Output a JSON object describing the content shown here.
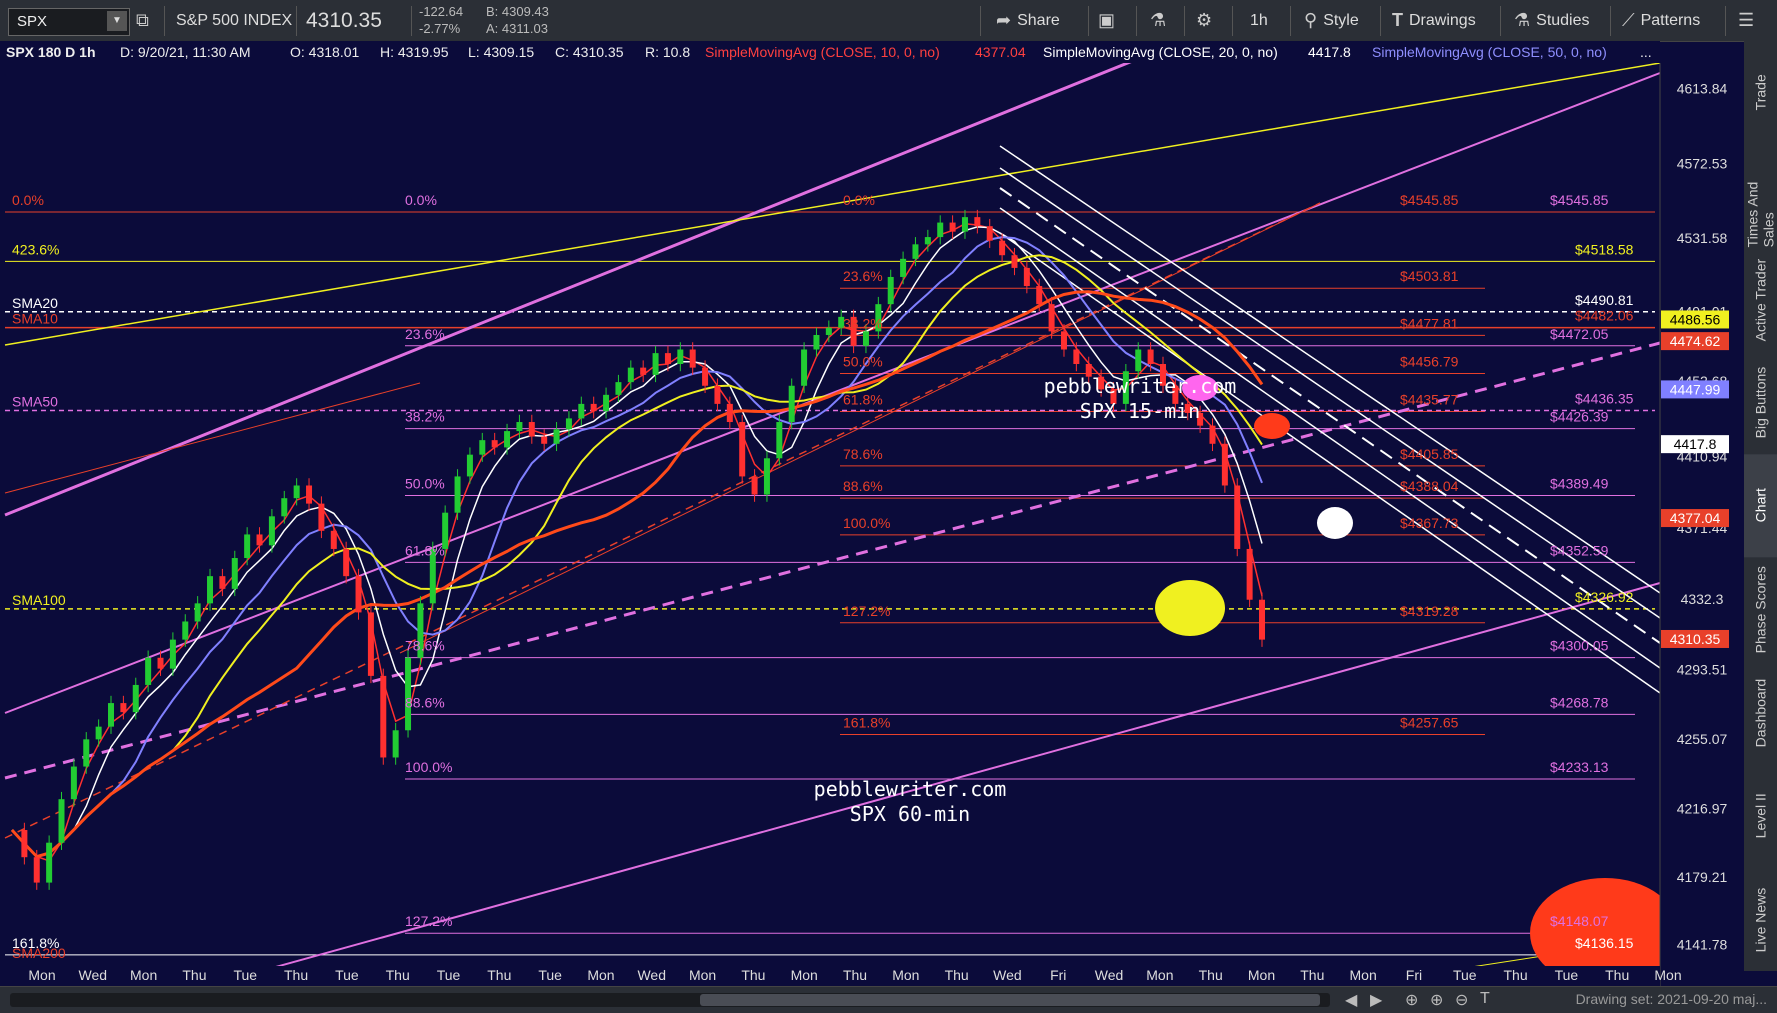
{
  "toolbar": {
    "symbol": "SPX",
    "index_name": "S&P 500 INDEX",
    "last_price": "4310.35",
    "change": "-122.64",
    "change_pct": "-2.77%",
    "bid": "B: 4309.43",
    "ask": "A: 4311.03",
    "share_label": "Share",
    "interval_label": "1h",
    "style_label": "Style",
    "drawings_label": "Drawings",
    "studies_label": "Studies",
    "patterns_label": "Patterns"
  },
  "infobar": {
    "symbol_period": "SPX 180 D 1h",
    "datetime": "D: 9/20/21, 11:30 AM",
    "open": "O: 4318.01",
    "high": "H: 4319.95",
    "low": "L: 4309.15",
    "close": "C: 4310.35",
    "range": "R: 10.8",
    "sma10_label": "SimpleMovingAvg (CLOSE, 10, 0, no)",
    "sma10_value": "4377.04",
    "sma20_label": "SimpleMovingAvg (CLOSE, 20, 0, no)",
    "sma20_value": "4417.8",
    "sma50_label": "SimpleMovingAvg (CLOSE, 50, 0, no)",
    "ellipsis": "..."
  },
  "right_tabs": [
    "Trade",
    "Times And Sales",
    "Active Trader",
    "Big Buttons",
    "Chart",
    "Phase Scores",
    "Dashboard",
    "Level II",
    "Live News"
  ],
  "bottombar": {
    "drawing_set": "Drawing set: 2021-09-20 maj..."
  },
  "colors": {
    "background": "#0b0b3a",
    "fib_red": "#e8402a",
    "fib_pink": "#e070e0",
    "yellow": "#f0f020",
    "white": "#ffffff",
    "sma200": "#ff4a1a",
    "sma50": "#8080ff"
  },
  "chart_data": {
    "type": "candlestick",
    "symbol": "SPX",
    "interval": "1h",
    "y_axis": {
      "ylim": [
        4130,
        4628
      ],
      "ticks": [
        4613.84,
        4572.53,
        4531.58,
        4491.01,
        4452.68,
        4410.94,
        4371.44,
        4332.3,
        4293.51,
        4255.07,
        4216.97,
        4179.21,
        4141.78
      ],
      "tick_labels": [
        "4613.84",
        "4572.53",
        "4531.58",
        "4491.01",
        "4452.68",
        "4410.94",
        "4371.44",
        "4332.3",
        "4293.51",
        "4255.07",
        "4216.97",
        "4179.21",
        "4141.78"
      ]
    },
    "x_axis": {
      "tick_labels": [
        "Mon",
        "Wed",
        "Mon",
        "Thu",
        "Tue",
        "Thu",
        "Tue",
        "Thu",
        "Tue",
        "Thu",
        "Tue",
        "Mon",
        "Wed",
        "Mon",
        "Thu",
        "Mon",
        "Thu",
        "Mon",
        "Thu",
        "Wed",
        "Fri",
        "Wed",
        "Mon",
        "Thu",
        "Mon",
        "Thu",
        "Mon",
        "Fri",
        "Tue",
        "Thu",
        "Tue",
        "Thu",
        "Mon"
      ]
    },
    "price_markers": [
      {
        "label": "4486.56",
        "value": 4486.56,
        "color": "#f0f020",
        "text_color": "#000000"
      },
      {
        "label": "4474.62",
        "value": 4474.62,
        "color": "#e8402a",
        "text_color": "#ffffff"
      },
      {
        "label": "4447.99",
        "value": 4447.99,
        "color": "#8080ff",
        "text_color": "#ffffff"
      },
      {
        "label": "4417.8",
        "value": 4417.8,
        "color": "#ffffff",
        "text_color": "#000000"
      },
      {
        "label": "4377.04",
        "value": 4377.04,
        "color": "#e8402a",
        "text_color": "#ffffff"
      },
      {
        "label": "4310.35",
        "value": 4310.35,
        "color": "#e8402a",
        "text_color": "#ffffff"
      }
    ],
    "fib_levels_left": [
      {
        "label": "0.0%",
        "value": 4545.85,
        "color": "#e8402a"
      },
      {
        "label": "423.6%",
        "value": 4518.58,
        "color": "#f0f020"
      },
      {
        "label": "161.8%",
        "value": 4136.15,
        "color": "#ffffff"
      }
    ],
    "fib_levels_pink": [
      {
        "label": "0.0%",
        "value": 4545.85,
        "price": "$4545.85"
      },
      {
        "label": "23.6%",
        "value": 4472.05,
        "price": "$4472.05"
      },
      {
        "label": "38.2%",
        "value": 4426.39,
        "price": "$4426.39"
      },
      {
        "label": "50.0%",
        "value": 4389.49,
        "price": "$4389.49"
      },
      {
        "label": "61.8%",
        "value": 4352.59,
        "price": "$4352.59"
      },
      {
        "label": "78.6%",
        "value": 4300.05,
        "price": "$4300.05"
      },
      {
        "label": "88.6%",
        "value": 4268.78,
        "price": "$4268.78"
      },
      {
        "label": "100.0%",
        "value": 4233.13,
        "price": "$4233.13"
      },
      {
        "label": "127.2%",
        "value": 4148.07,
        "price": "$4148.07"
      }
    ],
    "fib_levels_red": [
      {
        "label": "0.0%",
        "value": 4545.85,
        "price": "$4545.85"
      },
      {
        "label": "23.6%",
        "value": 4503.81,
        "price": "$4503.81"
      },
      {
        "label": "38.2%",
        "value": 4477.81,
        "price": "$4477.81"
      },
      {
        "label": "50.0%",
        "value": 4456.79,
        "price": "$4456.79"
      },
      {
        "label": "61.8%",
        "value": 4435.77,
        "price": "$4435.77"
      },
      {
        "label": "78.6%",
        "value": 4405.85,
        "price": "$4405.85"
      },
      {
        "label": "88.6%",
        "value": 4388.04,
        "price": "$4388.04"
      },
      {
        "label": "100.0%",
        "value": 4367.73,
        "price": "$4367.73"
      },
      {
        "label": "127.2%",
        "value": 4319.28,
        "price": "$4319.28"
      },
      {
        "label": "161.8%",
        "value": 4257.65,
        "price": "$4257.65"
      }
    ],
    "other_levels": [
      {
        "label": "$4518.58",
        "value": 4518.58,
        "color": "#f0f020"
      },
      {
        "label": "$4490.81",
        "value": 4490.81,
        "color": "#ffffff"
      },
      {
        "label": "$4482.06",
        "value": 4482.06,
        "color": "#e8402a"
      },
      {
        "label": "$4436.35",
        "value": 4436.35,
        "color": "#e070e0"
      },
      {
        "label": "$4326.92",
        "value": 4326.92,
        "color": "#f0f020"
      },
      {
        "label": "$4136.15",
        "value": 4136.15,
        "color": "#ffffff"
      }
    ],
    "sma_labels": [
      {
        "label": "SMA20",
        "value": 4490.81,
        "color": "#ffffff"
      },
      {
        "label": "SMA10",
        "value": 4482.06,
        "color": "#e8402a"
      },
      {
        "label": "SMA50",
        "value": 4436.35,
        "color": "#e070e0"
      },
      {
        "label": "SMA100",
        "value": 4326.92,
        "color": "#f0f020"
      },
      {
        "label": "SMA200",
        "value": 4130,
        "color": "#e8402a"
      }
    ],
    "annotations": [
      {
        "line1": "pebblewriter.com",
        "line2": "SPX 15-min"
      },
      {
        "line1": "pebblewriter.com",
        "line2": "SPX 60-min"
      }
    ],
    "price_series": [
      4205,
      4190,
      4176,
      4198,
      4222,
      4240,
      4255,
      4262,
      4275,
      4270,
      4285,
      4300,
      4294,
      4310,
      4320,
      4330,
      4345,
      4338,
      4355,
      4368,
      4362,
      4378,
      4388,
      4395,
      4385,
      4370,
      4360,
      4345,
      4325,
      4290,
      4245,
      4260,
      4300,
      4330,
      4360,
      4380,
      4400,
      4412,
      4420,
      4416,
      4425,
      4430,
      4422,
      4418,
      4426,
      4432,
      4440,
      4436,
      4445,
      4452,
      4460,
      4456,
      4468,
      4462,
      4470,
      4460,
      4450,
      4440,
      4430,
      4400,
      4390,
      4410,
      4430,
      4450,
      4470,
      4478,
      4482,
      4488,
      4472,
      4480,
      4495,
      4510,
      4520,
      4528,
      4532,
      4540,
      4535,
      4543,
      4538,
      4530,
      4522,
      4515,
      4505,
      4495,
      4480,
      4470,
      4462,
      4455,
      4448,
      4440,
      4458,
      4470,
      4462,
      4450,
      4440,
      4435,
      4428,
      4418,
      4395,
      4360,
      4332,
      4310
    ]
  }
}
